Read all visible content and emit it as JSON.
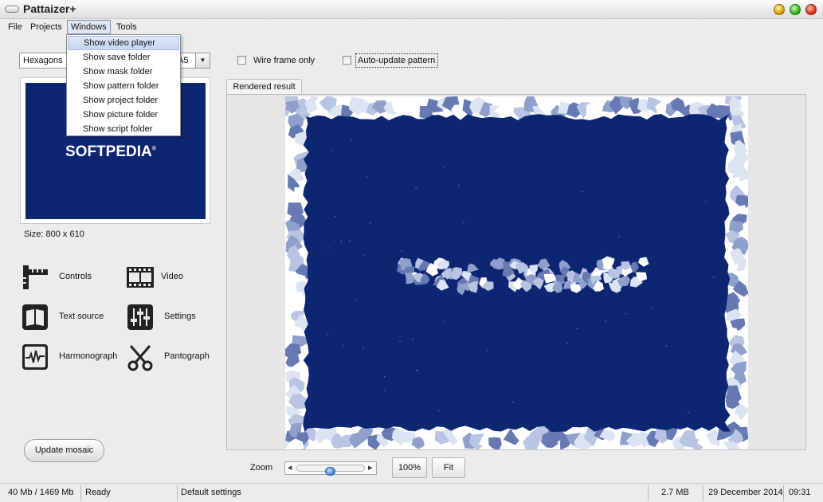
{
  "window": {
    "title": "Pattaizer+"
  },
  "menubar": {
    "items": [
      "File",
      "Projects",
      "Windows",
      "Tools"
    ]
  },
  "windows_menu": {
    "items": [
      "Show video player",
      "Show save folder",
      "Show mask folder",
      "Show pattern folder",
      "Show project folder",
      "Show picture folder",
      "Show script folder"
    ],
    "highlighted": "Show video player"
  },
  "pattern_combo": {
    "value": "Hexagons",
    "value_tail": "A5"
  },
  "options": {
    "wire_frame_label": "Wire frame only",
    "auto_update_label": "Auto-update pattern"
  },
  "preview": {
    "logo_text": "SOFTPEDIA",
    "logo_mark": "®",
    "size_label": "Size: 800 x 610"
  },
  "tools": [
    {
      "label": "Controls",
      "icon": "ruler-icon"
    },
    {
      "label": "Video",
      "icon": "film-icon"
    },
    {
      "label": "Text source",
      "icon": "book-icon"
    },
    {
      "label": "Settings",
      "icon": "sliders-icon"
    },
    {
      "label": "Harmonograph",
      "icon": "waveform-icon"
    },
    {
      "label": "Pantograph",
      "icon": "scissors-icon"
    }
  ],
  "update_button": {
    "label": "Update mosaic"
  },
  "result_tab": {
    "label": "Rendered result"
  },
  "zoom": {
    "label": "Zoom",
    "left_arrow": "◀",
    "right_arrow": "▶",
    "value_percent": 48,
    "percent_button": "100%",
    "fit_button": "Fit"
  },
  "status": {
    "memory": "40 Mb / 1469 Mb",
    "state": "Ready",
    "settings": "Default settings",
    "file_size": "2.7 MB",
    "date": "29 December 2014",
    "time": "09:31"
  },
  "colors": {
    "mosaic_blue": "#0d2672",
    "tile_light": "#dce3f2",
    "tile_mid": "#8f9fcb",
    "accent_highlight": "#c4d5f2"
  }
}
